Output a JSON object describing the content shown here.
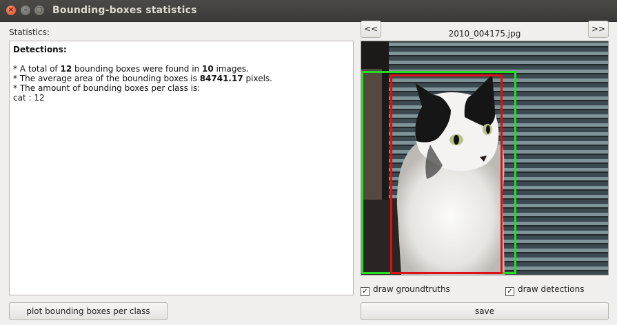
{
  "window": {
    "title": "Bounding-boxes statistics",
    "close_glyph": "×",
    "min_glyph": "–",
    "max_glyph": "□"
  },
  "stats": {
    "label": "Statistics:",
    "heading": "Detections:",
    "line1_pre": "* A total of ",
    "total_boxes": "12",
    "line1_mid": " bounding boxes were found in ",
    "total_images": "10",
    "line1_post": " images.",
    "line2_pre": "* The average area of the bounding boxes is ",
    "avg_area": "84741.17",
    "line2_post": " pixels.",
    "line3": "* The amount of bounding boxes per class is:",
    "class_line": "cat : 12"
  },
  "viewer": {
    "prev_label": "<<",
    "next_label": ">>",
    "filename": "2010_004175.jpg",
    "groundtruth_color": "#22dd22",
    "detection_color": "#dd1111",
    "draw_groundtruths_label": "draw groundtruths",
    "draw_groundtruths_checked": true,
    "draw_detections_label": "draw detections",
    "draw_detections_checked": true,
    "check_glyph": "✓"
  },
  "buttons": {
    "plot_label": "plot bounding boxes per class",
    "save_label": "save"
  }
}
